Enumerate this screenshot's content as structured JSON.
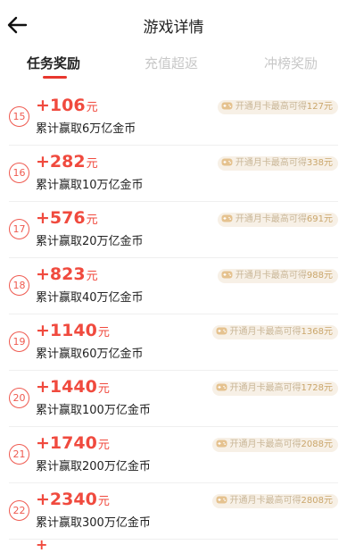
{
  "header": {
    "title": "游戏详情"
  },
  "tabs": [
    {
      "label": "任务奖励",
      "active": true
    },
    {
      "label": "充值超返",
      "active": false
    },
    {
      "label": "冲榜奖励",
      "active": false
    }
  ],
  "badge_prefix": "开通月卡最高可得",
  "rows": [
    {
      "num": "15",
      "amount": "+106",
      "unit": "元",
      "desc": "累计赢取6万亿金币",
      "max": "127元"
    },
    {
      "num": "16",
      "amount": "+282",
      "unit": "元",
      "desc": "累计赢取10万亿金币",
      "max": "338元"
    },
    {
      "num": "17",
      "amount": "+576",
      "unit": "元",
      "desc": "累计赢取20万亿金币",
      "max": "691元"
    },
    {
      "num": "18",
      "amount": "+823",
      "unit": "元",
      "desc": "累计赢取40万亿金币",
      "max": "988元"
    },
    {
      "num": "19",
      "amount": "+1140",
      "unit": "元",
      "desc": "累计赢取60万亿金币",
      "max": "1368元"
    },
    {
      "num": "20",
      "amount": "+1440",
      "unit": "元",
      "desc": "累计赢取100万亿金币",
      "max": "1728元"
    },
    {
      "num": "21",
      "amount": "+1740",
      "unit": "元",
      "desc": "累计赢取200万亿金币",
      "max": "2088元"
    },
    {
      "num": "22",
      "amount": "+2340",
      "unit": "元",
      "desc": "累计赢取300万亿金币",
      "max": "2808元"
    }
  ],
  "colors": {
    "accent": "#f04a3e",
    "badge_bg": "#f7f0e6",
    "badge_text": "#c9b697"
  },
  "icons": {
    "back": "arrow-left-icon",
    "badge": "gamepad-icon"
  }
}
